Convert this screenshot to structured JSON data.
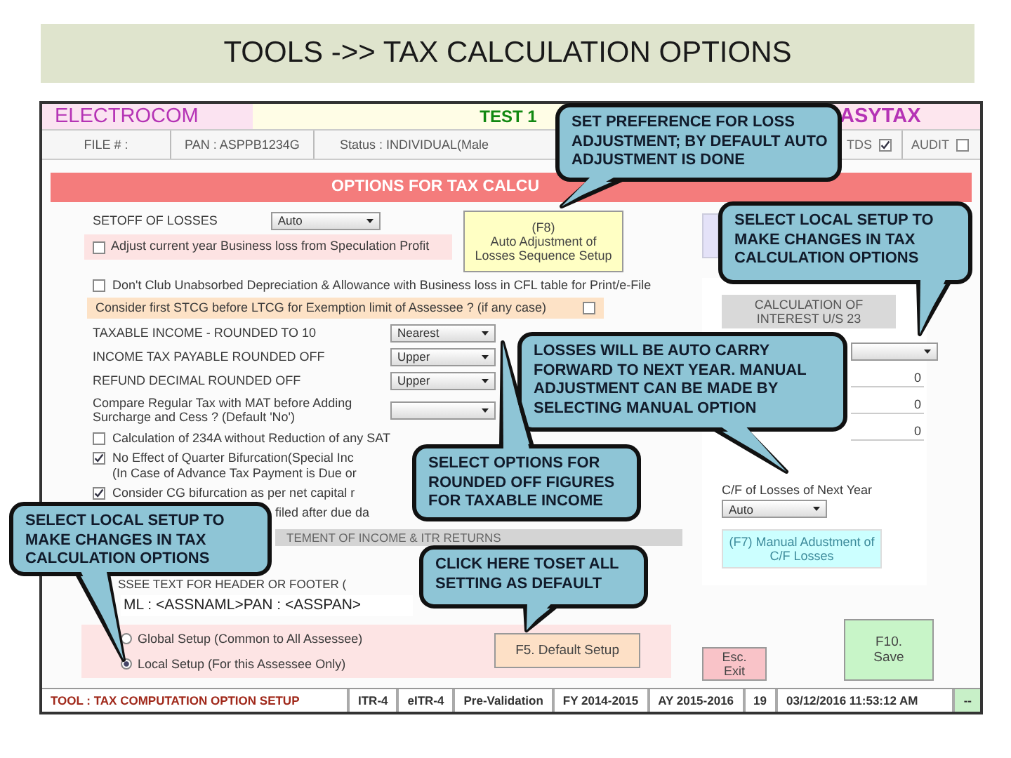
{
  "slide_title": "TOOLS ->> TAX CALCULATION OPTIONS",
  "header": {
    "company": "ELECTROCOM",
    "assessee": "TEST 1",
    "product": "ASYTAX"
  },
  "info": [
    "FILE # :",
    "PAN : ASPPB1234G",
    "Status : INDIVIDUAL(Male"
  ],
  "flags": [
    {
      "label": "TDS",
      "checked": true
    },
    {
      "label": "AUDIT",
      "checked": false
    }
  ],
  "section_title": "OPTIONS FOR TAX CALCU",
  "setoff": {
    "label": "SETOFF OF LOSSES",
    "value": "Auto",
    "option": {
      "text": "Adjust current year Business loss from Speculation Profit",
      "checked": false
    },
    "button": [
      "(F8)",
      "Auto Adjustment of",
      "Losses Sequence Setup"
    ]
  },
  "options": [
    {
      "kind": "check",
      "lines": [
        "Don't Club Unabsorbed Depreciation & Allowance with Business loss in CFL table for Print/e-File"
      ],
      "checked": false
    },
    {
      "kind": "note",
      "lines": [
        "Consider first STCG before LTCG for Exemption limit of Assessee ? (if any case)"
      ],
      "checked": false
    },
    {
      "kind": "select",
      "lines": [
        "TAXABLE INCOME - ROUNDED TO 10"
      ],
      "value": "Nearest"
    },
    {
      "kind": "select",
      "lines": [
        "INCOME TAX PAYABLE ROUNDED OFF"
      ],
      "value": "Upper"
    },
    {
      "kind": "select",
      "lines": [
        "REFUND DECIMAL ROUNDED OFF"
      ],
      "value": "Upper"
    },
    {
      "kind": "select",
      "lines": [
        "Compare Regular Tax with MAT before Adding",
        "Surcharge and Cess ?   (Default 'No')"
      ]
    },
    {
      "kind": "check",
      "lines": [
        "Calculation of 234A without Reduction of any SAT"
      ],
      "checked": false
    },
    {
      "kind": "check",
      "lines": [
        "No Effect of Quarter Bifurcation(Special Inc",
        "(In Case of Advance Tax Payment is Due or"
      ],
      "checked": true
    },
    {
      "kind": "check",
      "lines": [
        "Consider CG bifurcation as per net capital r"
      ],
      "checked": true
    },
    {
      "kind": "text",
      "lines": [
        "filed after due da"
      ]
    }
  ],
  "statement_bar": "TEMENT OF INCOME & ITR RETURNS",
  "header_text": {
    "label": "SSEE TEXT FOR HEADER OR FOOTER (",
    "value": "ML : <ASSNAML>PAN : <ASSPAN>"
  },
  "scope": [
    {
      "label": "Global Setup (Common to All Assessee)",
      "selected": false
    },
    {
      "label": "Local Setup (For this Assessee Only)",
      "selected": true
    }
  ],
  "buttons": [
    {
      "kind": "default",
      "lines": [
        "F5. Default Setup"
      ]
    },
    {
      "kind": "exit",
      "lines": [
        "Esc.",
        "Exit"
      ]
    },
    {
      "kind": "save",
      "lines": [
        "F10.",
        "Save"
      ]
    }
  ],
  "interest": {
    "button": [
      "CALCULATION OF",
      "INTEREST U/S 23"
    ],
    "amounts": [
      "0",
      "0",
      "0"
    ]
  },
  "carry_forward": {
    "label": "C/F of Losses of Next Year",
    "value": "Auto",
    "button": [
      "(F7)  Manual Adustment of",
      "C/F Losses"
    ]
  },
  "status_bar": [
    "TOOL : TAX COMPUTATION OPTION SETUP",
    "ITR-4",
    "eITR-4",
    "Pre-Validation",
    "FY 2014-2015",
    "AY 2015-2016",
    "19",
    "03/12/2016 11:53:12 AM",
    "--"
  ],
  "callouts": [
    "SET PREFERENCE FOR LOSS ADJUSTMENT; BY DEFAULT AUTO ADJUSTMENT IS DONE",
    "SELECT LOCAL SETUP TO MAKE CHANGES IN TAX CALCULATION OPTIONS",
    "LOSSES WILL BE AUTO CARRY FORWARD TO NEXT YEAR. MANUAL ADJUSTMENT CAN BE MADE BY SELECTING MANUAL OPTION",
    "SELECT OPTIONS FOR ROUNDED OFF FIGURES FOR TAXABLE INCOME",
    "SELECT LOCAL SETUP TO MAKE CHANGES IN TAX CALCULATION OPTIONS",
    "CLICK HERE TOSET ALL SETTING AS DEFAULT"
  ]
}
